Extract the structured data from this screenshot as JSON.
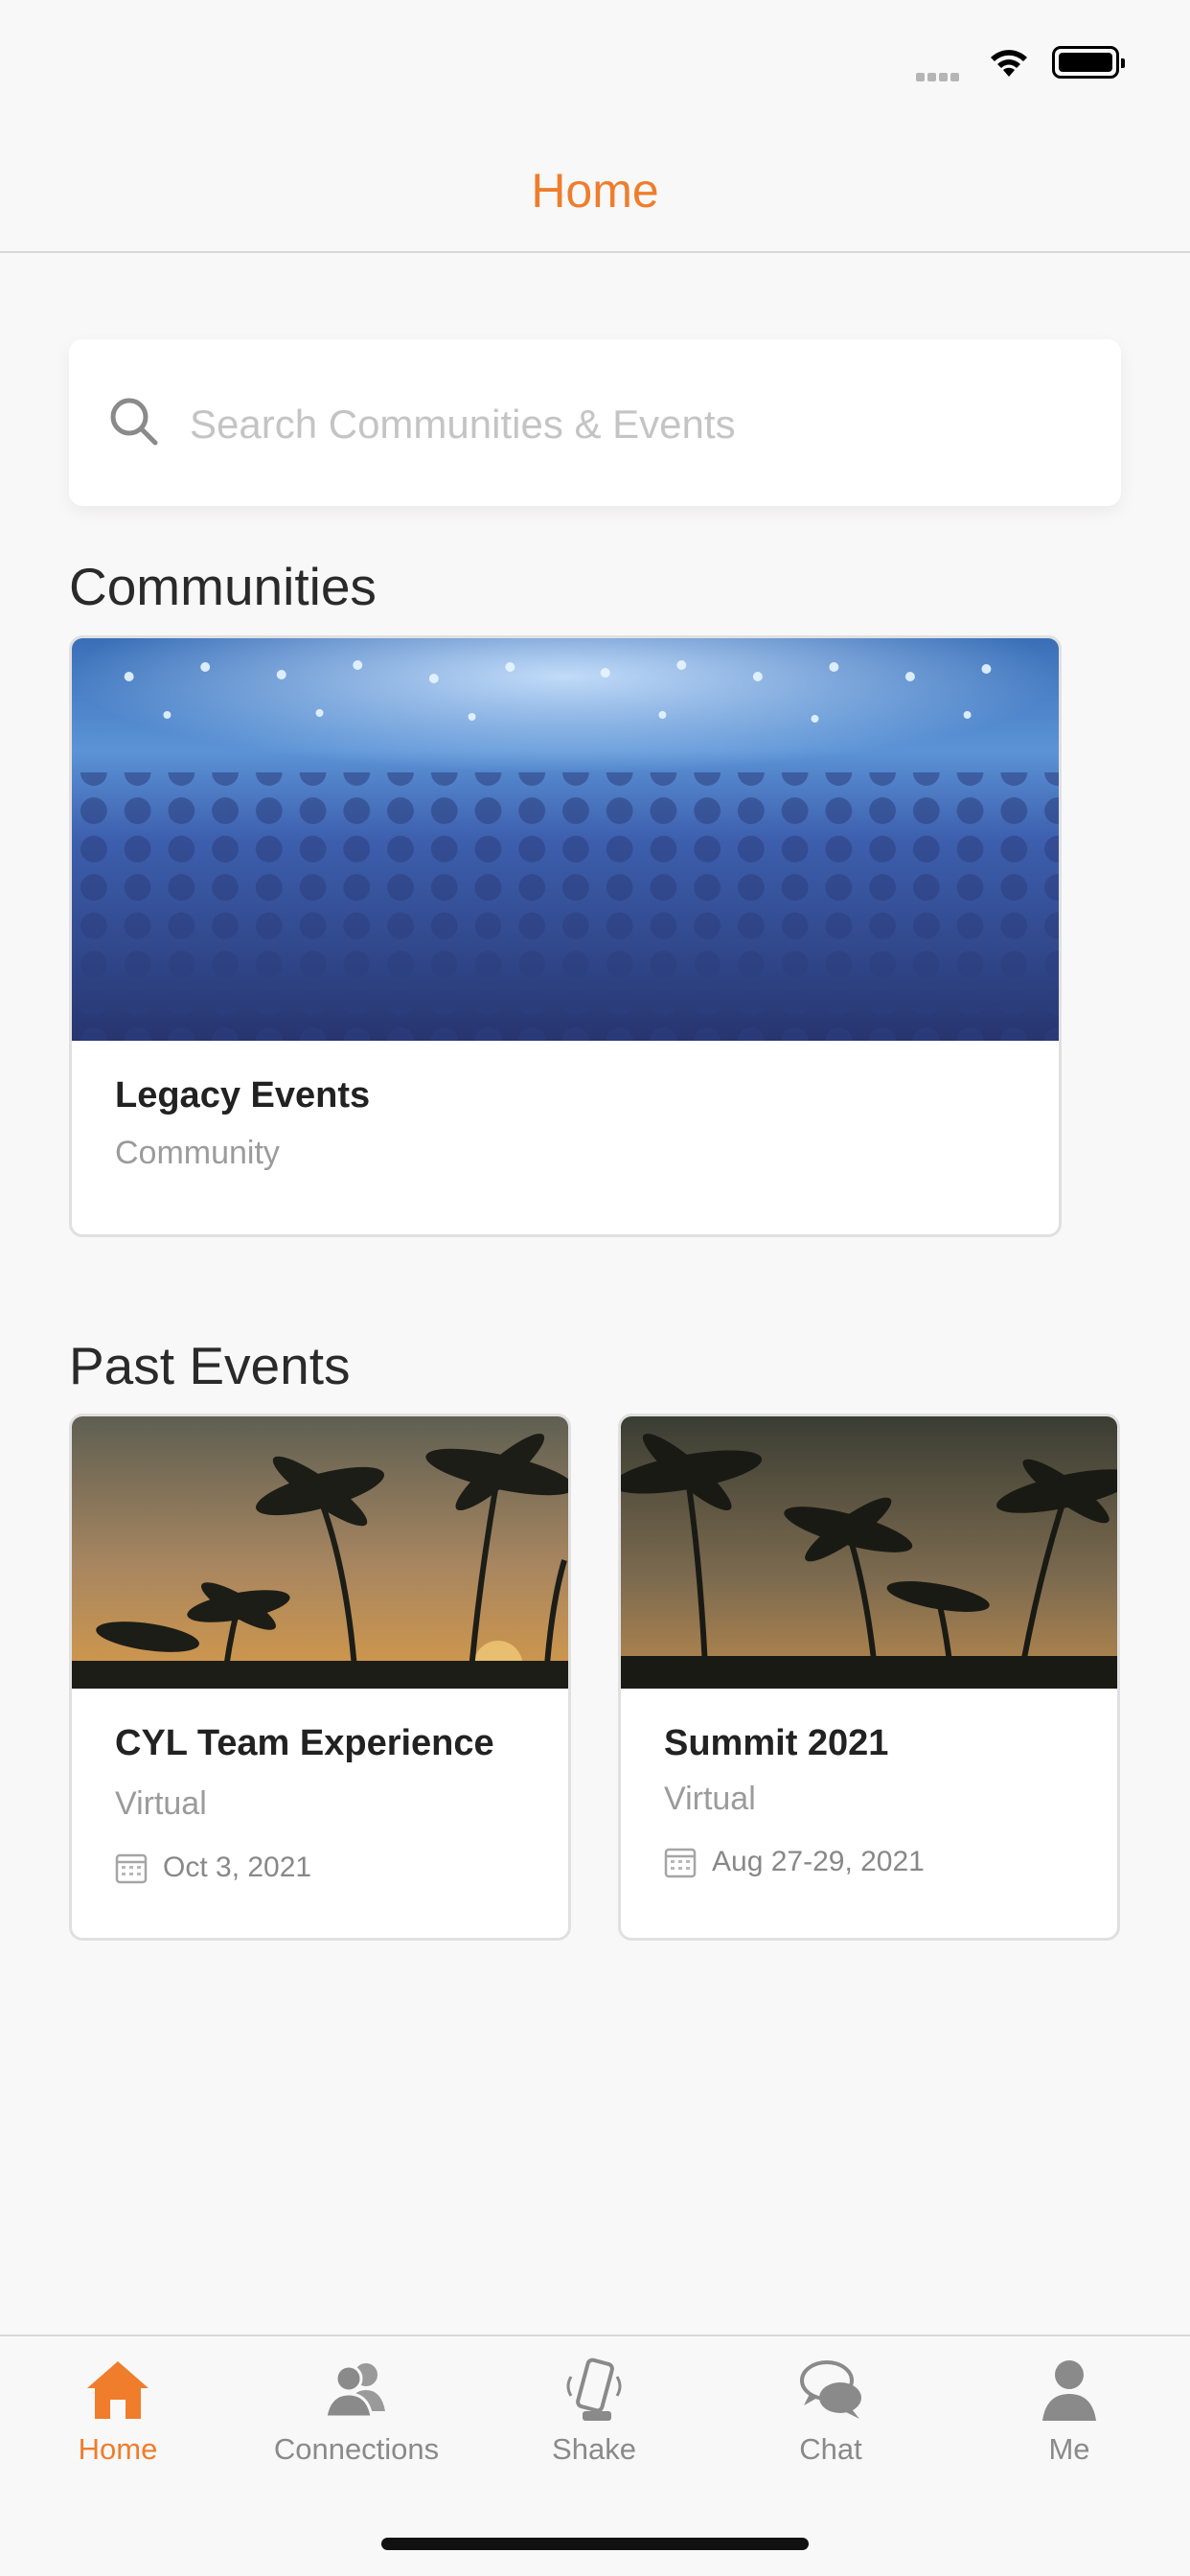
{
  "header": {
    "title": "Home"
  },
  "search": {
    "placeholder": "Search Communities & Events"
  },
  "communities": {
    "section_title": "Communities",
    "items": [
      {
        "title": "Legacy Events",
        "subtitle": "Community"
      }
    ]
  },
  "past_events": {
    "section_title": "Past Events",
    "items": [
      {
        "title": "CYL Team Experience",
        "subtitle": "Virtual",
        "date": "Oct  3, 2021"
      },
      {
        "title": "Summit 2021",
        "subtitle": "Virtual",
        "date": "Aug 27-29, 2021"
      }
    ]
  },
  "tab_bar": {
    "items": [
      {
        "label": "Home",
        "icon": "home-icon",
        "active": true
      },
      {
        "label": "Connections",
        "icon": "people-icon",
        "active": false
      },
      {
        "label": "Shake",
        "icon": "phone-shake-icon",
        "active": false
      },
      {
        "label": "Chat",
        "icon": "chat-bubbles-icon",
        "active": false
      },
      {
        "label": "Me",
        "icon": "person-icon",
        "active": false
      }
    ]
  },
  "colors": {
    "accent": "#ef7d2c",
    "inactive": "#8a8a8a",
    "background": "#f9f8f8"
  }
}
